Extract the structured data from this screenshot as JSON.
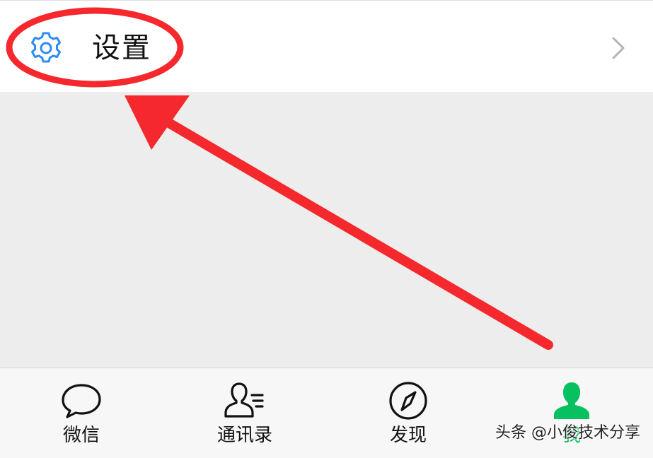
{
  "settings_row": {
    "label": "设置",
    "icon": "gear-icon",
    "chevron": "chevron-right-icon"
  },
  "tab_bar": {
    "tabs": [
      {
        "label": "微信",
        "icon": "chat-bubble-icon",
        "active": false
      },
      {
        "label": "通讯录",
        "icon": "contacts-icon",
        "active": false
      },
      {
        "label": "发现",
        "icon": "compass-icon",
        "active": false
      },
      {
        "label": "我",
        "icon": "person-icon",
        "active": true
      }
    ]
  },
  "annotation": {
    "highlight": "red-ellipse",
    "pointer": "red-arrow"
  },
  "watermark": {
    "text": "头条 @小俊技术分享"
  },
  "colors": {
    "accent_green": "#07c160",
    "gear_blue": "#2d8cf0",
    "annotation_red": "#f4282d",
    "background": "#ededed"
  }
}
